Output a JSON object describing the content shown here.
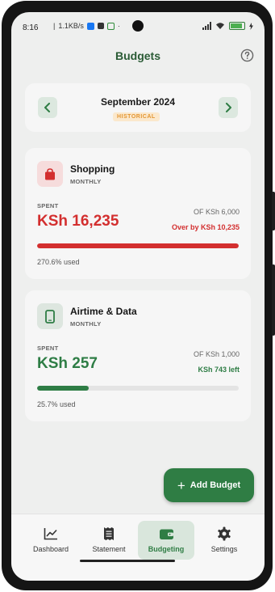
{
  "status_bar": {
    "time": "8:16",
    "speed": "1.1KB/s",
    "battery_level": 0.9
  },
  "header": {
    "title": "Budgets",
    "help_icon": "help-circle-icon"
  },
  "month_selector": {
    "label": "September 2024",
    "badge": "HISTORICAL",
    "prev_icon": "chevron-left-icon",
    "next_icon": "chevron-right-icon"
  },
  "budgets": [
    {
      "name": "Shopping",
      "period": "MONTHLY",
      "icon": "shopping-bag-icon",
      "spent_label": "SPENT",
      "spent": "KSh 16,235",
      "of_total": "OF KSh 6,000",
      "status": "Over by KSh 10,235",
      "used": "270.6% used",
      "progress": 1.0,
      "color": "#d32f2f"
    },
    {
      "name": "Airtime & Data",
      "period": "MONTHLY",
      "icon": "smartphone-icon",
      "spent_label": "SPENT",
      "spent": "KSh 257",
      "of_total": "OF KSh 1,000",
      "status": "KSh 743 left",
      "used": "25.7% used",
      "progress": 0.257,
      "color": "#2e7d45"
    }
  ],
  "fab": {
    "label": "Add Budget",
    "icon": "plus-icon"
  },
  "bottom_nav": {
    "items": [
      {
        "label": "Dashboard",
        "icon": "chart-line-icon",
        "active": false
      },
      {
        "label": "Statement",
        "icon": "receipt-icon",
        "active": false
      },
      {
        "label": "Budgeting",
        "icon": "wallet-icon",
        "active": true
      },
      {
        "label": "Settings",
        "icon": "gear-icon",
        "active": false
      }
    ]
  },
  "colors": {
    "brand": "#2f7d44",
    "danger": "#d32f2f",
    "badge": "#e39632"
  }
}
